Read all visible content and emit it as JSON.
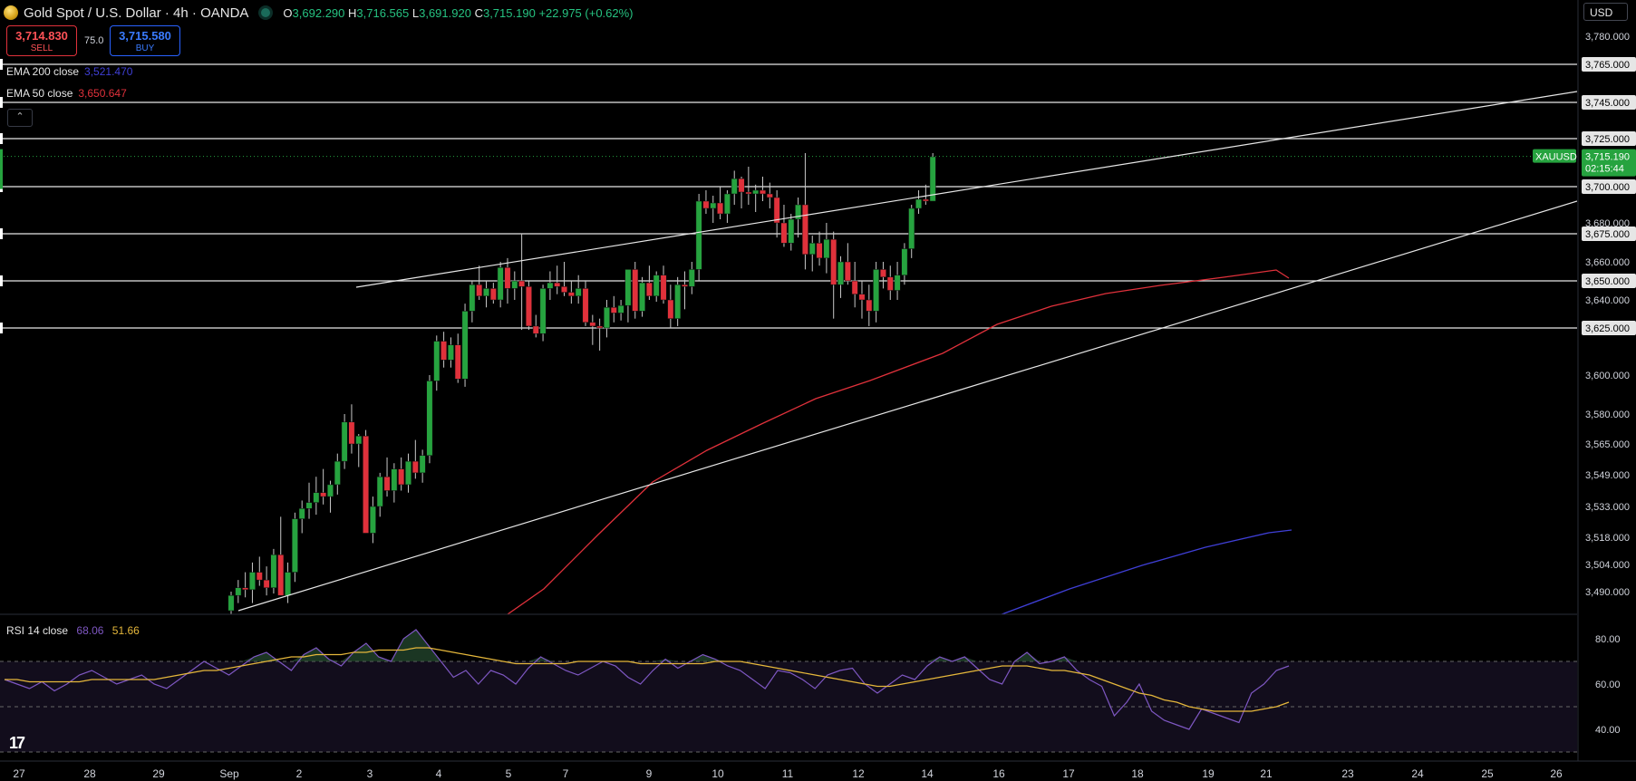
{
  "header": {
    "title": "Gold Spot / U.S. Dollar · 4h · OANDA",
    "ohlc": {
      "o_label": "O",
      "o": "3,692.290",
      "h_label": "H",
      "h": "3,716.565",
      "l_label": "L",
      "l": "3,691.920",
      "c_label": "C",
      "c": "3,715.190",
      "change": "+22.975 (+0.62%)"
    }
  },
  "trade": {
    "sell_price": "3,714.830",
    "sell_label": "SELL",
    "spread": "75.0",
    "buy_price": "3,715.580",
    "buy_label": "BUY"
  },
  "indicators": {
    "ema200_label": "EMA 200 close",
    "ema200_value": "3,521.470",
    "ema200_color": "#3f3fd6",
    "ema50_label": "EMA 50 close",
    "ema50_value": "3,650.647",
    "ema50_color": "#e0313b",
    "rsi_label": "RSI 14 close",
    "rsi_value": "68.06",
    "rsi_ma_value": "51.66",
    "rsi_color": "#7e57c2",
    "rsi_ma_color": "#e5b73b",
    "collapse_icon": "chevron-up-icon"
  },
  "price_axis": {
    "currency": "USD",
    "labels": [
      "3,780.000",
      "3,765.000",
      "3,745.000",
      "3,725.000",
      "3,700.000",
      "3,680.000",
      "3,675.000",
      "3,660.000",
      "3,650.000",
      "3,640.000",
      "3,625.000",
      "3,600.000",
      "3,580.000",
      "3,565.000",
      "3,549.000",
      "3,533.000",
      "3,518.000",
      "3,504.000",
      "3,490.000"
    ],
    "boxed": [
      "3,765.000",
      "3,745.000",
      "3,725.000",
      "3,700.000",
      "3,675.000",
      "3,650.000",
      "3,625.000"
    ],
    "current_symbol": "XAUUSD",
    "current_price": "3,715.190",
    "countdown": "02:15:44"
  },
  "rsi_axis": {
    "labels": [
      "80.00",
      "60.00",
      "40.00"
    ]
  },
  "time_axis": {
    "labels": [
      "27",
      "28",
      "29",
      "Sep",
      "2",
      "3",
      "4",
      "5",
      "7",
      "9",
      "10",
      "11",
      "12",
      "14",
      "16",
      "17",
      "18",
      "19",
      "21",
      "23",
      "24",
      "25",
      "26"
    ]
  },
  "colors": {
    "up": "#26a33f",
    "down": "#e0313b",
    "level_line": "#e6e6e6",
    "current_line": "#26a33f"
  },
  "logo": "TradingView",
  "chart_data": {
    "type": "candlestick",
    "ylim": [
      3480,
      3790
    ],
    "levels": [
      3765,
      3745,
      3725,
      3700,
      3675,
      3650,
      3625
    ],
    "current_price": 3715.19,
    "candles": [
      [
        3480,
        3490,
        3470,
        3488
      ],
      [
        3488,
        3496,
        3484,
        3492
      ],
      [
        3492,
        3500,
        3487,
        3491
      ],
      [
        3491,
        3505,
        3484,
        3500
      ],
      [
        3500,
        3508,
        3493,
        3496
      ],
      [
        3496,
        3503,
        3488,
        3492
      ],
      [
        3492,
        3512,
        3489,
        3509
      ],
      [
        3509,
        3528,
        3505,
        3488
      ],
      [
        3488,
        3505,
        3484,
        3500
      ],
      [
        3500,
        3530,
        3495,
        3527
      ],
      [
        3527,
        3536,
        3520,
        3532
      ],
      [
        3532,
        3545,
        3527,
        3535
      ],
      [
        3535,
        3548,
        3529,
        3540
      ],
      [
        3540,
        3552,
        3534,
        3538
      ],
      [
        3538,
        3546,
        3530,
        3544
      ],
      [
        3544,
        3560,
        3539,
        3556
      ],
      [
        3556,
        3580,
        3552,
        3576
      ],
      [
        3576,
        3585,
        3560,
        3565
      ],
      [
        3565,
        3570,
        3553,
        3569
      ],
      [
        3569,
        3572,
        3520,
        3520
      ],
      [
        3520,
        3538,
        3515,
        3533
      ],
      [
        3533,
        3550,
        3528,
        3548
      ],
      [
        3548,
        3558,
        3538,
        3541
      ],
      [
        3541,
        3555,
        3535,
        3552
      ],
      [
        3552,
        3558,
        3541,
        3544
      ],
      [
        3544,
        3560,
        3540,
        3556
      ],
      [
        3556,
        3567,
        3547,
        3550
      ],
      [
        3550,
        3562,
        3545,
        3559
      ],
      [
        3559,
        3600,
        3555,
        3597
      ],
      [
        3597,
        3621,
        3592,
        3618
      ],
      [
        3618,
        3623,
        3604,
        3608
      ],
      [
        3608,
        3620,
        3604,
        3616
      ],
      [
        3616,
        3622,
        3596,
        3598
      ],
      [
        3598,
        3638,
        3594,
        3634
      ],
      [
        3634,
        3650,
        3628,
        3648
      ],
      [
        3648,
        3658,
        3640,
        3642
      ],
      [
        3642,
        3650,
        3636,
        3646
      ],
      [
        3646,
        3649,
        3638,
        3640
      ],
      [
        3640,
        3660,
        3636,
        3657
      ],
      [
        3657,
        3662,
        3638,
        3646
      ],
      [
        3646,
        3655,
        3640,
        3650
      ],
      [
        3650,
        3675,
        3624,
        3647
      ],
      [
        3647,
        3650,
        3624,
        3626
      ],
      [
        3626,
        3632,
        3620,
        3622
      ],
      [
        3622,
        3648,
        3618,
        3646
      ],
      [
        3646,
        3655,
        3640,
        3649
      ],
      [
        3649,
        3658,
        3643,
        3647
      ],
      [
        3647,
        3660,
        3642,
        3644
      ],
      [
        3644,
        3650,
        3638,
        3642
      ],
      [
        3642,
        3653,
        3638,
        3646
      ],
      [
        3646,
        3650,
        3626,
        3628
      ],
      [
        3628,
        3632,
        3616,
        3626
      ],
      [
        3626,
        3630,
        3613,
        3625
      ],
      [
        3625,
        3640,
        3620,
        3636
      ],
      [
        3636,
        3642,
        3628,
        3633
      ],
      [
        3633,
        3640,
        3629,
        3637
      ],
      [
        3637,
        3652,
        3628,
        3656
      ],
      [
        3656,
        3660,
        3630,
        3634
      ],
      [
        3634,
        3652,
        3631,
        3649
      ],
      [
        3649,
        3658,
        3640,
        3642
      ],
      [
        3642,
        3655,
        3639,
        3653
      ],
      [
        3653,
        3658,
        3638,
        3640
      ],
      [
        3640,
        3648,
        3625,
        3630
      ],
      [
        3630,
        3652,
        3626,
        3648
      ],
      [
        3648,
        3655,
        3635,
        3647
      ],
      [
        3647,
        3660,
        3643,
        3656
      ],
      [
        3656,
        3696,
        3650,
        3692
      ],
      [
        3692,
        3698,
        3685,
        3688
      ],
      [
        3688,
        3695,
        3680,
        3691
      ],
      [
        3691,
        3700,
        3682,
        3685
      ],
      [
        3685,
        3698,
        3680,
        3696
      ],
      [
        3696,
        3708,
        3690,
        3704
      ],
      [
        3704,
        3705,
        3688,
        3697
      ],
      [
        3697,
        3710,
        3690,
        3696
      ],
      [
        3696,
        3701,
        3686,
        3698
      ],
      [
        3698,
        3705,
        3692,
        3696
      ],
      [
        3696,
        3702,
        3688,
        3694
      ],
      [
        3694,
        3698,
        3673,
        3680
      ],
      [
        3680,
        3690,
        3668,
        3670
      ],
      [
        3670,
        3685,
        3666,
        3682
      ],
      [
        3682,
        3694,
        3673,
        3690
      ],
      [
        3690,
        3717,
        3656,
        3664
      ],
      [
        3664,
        3674,
        3655,
        3670
      ],
      [
        3670,
        3676,
        3658,
        3662
      ],
      [
        3662,
        3680,
        3654,
        3672
      ],
      [
        3672,
        3676,
        3630,
        3648
      ],
      [
        3648,
        3663,
        3641,
        3660
      ],
      [
        3660,
        3670,
        3648,
        3650
      ],
      [
        3650,
        3660,
        3636,
        3643
      ],
      [
        3643,
        3650,
        3630,
        3640
      ],
      [
        3640,
        3648,
        3626,
        3634
      ],
      [
        3634,
        3660,
        3628,
        3656
      ],
      [
        3656,
        3660,
        3646,
        3652
      ],
      [
        3652,
        3658,
        3640,
        3645
      ],
      [
        3645,
        3660,
        3640,
        3653
      ],
      [
        3653,
        3670,
        3648,
        3667
      ],
      [
        3667,
        3690,
        3662,
        3688
      ],
      [
        3688,
        3698,
        3685,
        3693
      ],
      [
        3693,
        3701,
        3690,
        3692
      ],
      [
        3692,
        3717,
        3692,
        3715
      ]
    ],
    "rsi": [
      62,
      60,
      58,
      61,
      57,
      60,
      64,
      66,
      63,
      60,
      62,
      64,
      60,
      58,
      62,
      66,
      70,
      67,
      64,
      68,
      72,
      74,
      70,
      66,
      73,
      76,
      71,
      68,
      74,
      78,
      72,
      70,
      80,
      84,
      77,
      70,
      63,
      66,
      60,
      66,
      64,
      60,
      67,
      72,
      69,
      66,
      64,
      67,
      70,
      68,
      63,
      60,
      66,
      71,
      67,
      70,
      73,
      71,
      68,
      66,
      62,
      58,
      66,
      65,
      62,
      58,
      64,
      66,
      67,
      60,
      56,
      60,
      64,
      62,
      68,
      72,
      70,
      72,
      67,
      62,
      60,
      70,
      74,
      69,
      70,
      72,
      66,
      62,
      59,
      46,
      52,
      60,
      48,
      44,
      42,
      40,
      49,
      47,
      45,
      43,
      56,
      60,
      66,
      68
    ],
    "rsi_ma": [
      62,
      62,
      61,
      61,
      61,
      61,
      61,
      62,
      62,
      62,
      62,
      62,
      62,
      63,
      64,
      65,
      66,
      66,
      67,
      68,
      69,
      70,
      71,
      72,
      72,
      73,
      73,
      73,
      74,
      74,
      75,
      75,
      75,
      76,
      76,
      75,
      74,
      73,
      72,
      71,
      70,
      69,
      69,
      69,
      69,
      69,
      70,
      70,
      70,
      70,
      70,
      69,
      69,
      69,
      69,
      69,
      69,
      70,
      70,
      70,
      69,
      68,
      67,
      66,
      65,
      64,
      63,
      62,
      61,
      60,
      59,
      59,
      60,
      61,
      62,
      63,
      64,
      65,
      66,
      67,
      68,
      68,
      68,
      67,
      66,
      66,
      65,
      64,
      62,
      60,
      58,
      56,
      55,
      53,
      52,
      50,
      49,
      48,
      48,
      48,
      48,
      49,
      50,
      52
    ],
    "ema50": [
      [
        0,
        3450
      ],
      [
        0.1,
        3470
      ],
      [
        0.2,
        3500
      ],
      [
        0.3,
        3530
      ],
      [
        0.4,
        3555
      ],
      [
        0.5,
        3575
      ],
      [
        0.6,
        3592
      ],
      [
        0.7,
        3608
      ],
      [
        0.8,
        3625
      ],
      [
        0.9,
        3640
      ],
      [
        1,
        3650
      ]
    ],
    "ema200": [
      [
        0.75,
        3480
      ],
      [
        0.85,
        3495
      ],
      [
        0.92,
        3507
      ],
      [
        1,
        3521
      ]
    ],
    "trendlines": [
      {
        "from": [
          3660,
          3,
          3540
        ],
        "to_price": 3738
      },
      {
        "from": [
          3490,
          2,
          3475
        ],
        "to_price": 3690
      }
    ]
  }
}
